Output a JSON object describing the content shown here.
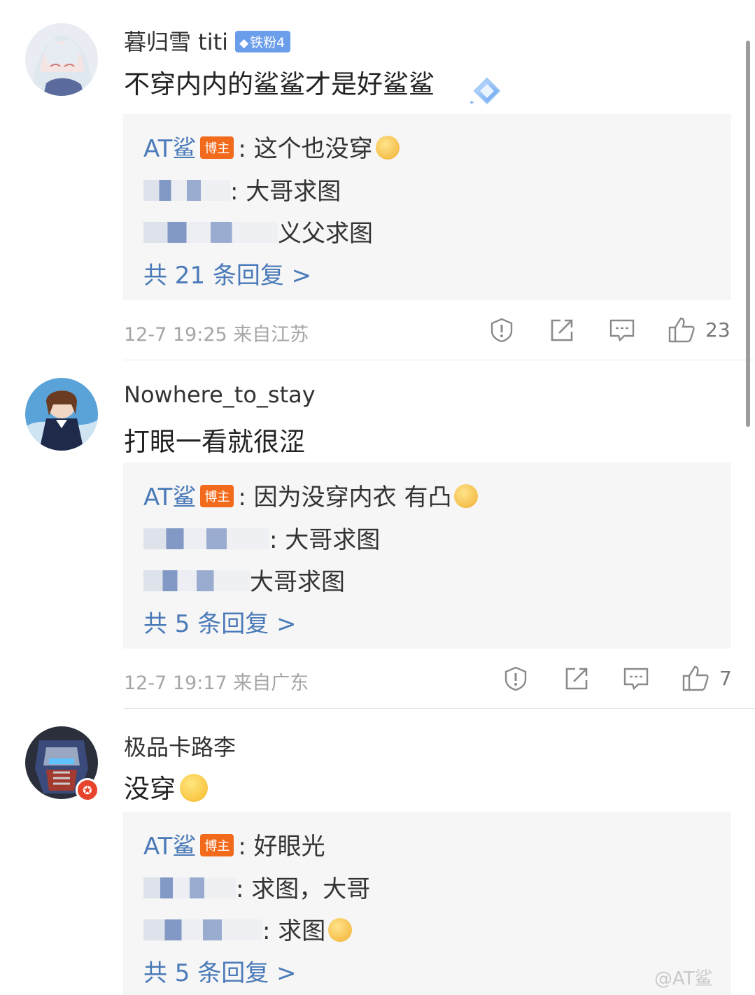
{
  "comments": [
    {
      "username": "暮归雪 titi",
      "badge": "铁粉4",
      "text": "不穿内内的鲨鲨才是好鲨鲨",
      "replies": [
        {
          "name": "AT鲨",
          "tag": "博主",
          "sep": ":",
          "text": " 这个也没穿"
        },
        {
          "name": "",
          "text": ": 大哥求图"
        },
        {
          "name": "",
          "text": "义父求图"
        }
      ],
      "more": "共 21 条回复 >",
      "time": "12-7 19:25",
      "location": "来自江苏",
      "likes": "23"
    },
    {
      "username": "Nowhere_to_stay",
      "text": "打眼一看就很涩",
      "replies": [
        {
          "name": "AT鲨",
          "tag": "博主",
          "sep": ":",
          "text": " 因为没穿内衣 有凸"
        },
        {
          "name": "",
          "text": ": 大哥求图"
        },
        {
          "name": "",
          "text": "大哥求图"
        }
      ],
      "more": "共 5 条回复 >",
      "time": "12-7 19:17",
      "location": "来自广东",
      "likes": "7"
    },
    {
      "username": "极品卡路李",
      "text": "没穿",
      "replies": [
        {
          "name": "AT鲨",
          "tag": "博主",
          "sep": ":",
          "text": " 好眼光"
        },
        {
          "name": "",
          "text": ": 求图，大哥"
        },
        {
          "name": "",
          "text": ": 求图"
        }
      ],
      "more": "共 5 条回复 >"
    }
  ],
  "watermark": "@AT鲨",
  "icons": {
    "report": "shield-exclamation-icon",
    "share": "share-icon",
    "comment": "comment-icon",
    "like": "thumbs-up-icon"
  },
  "colors": {
    "link": "#4a7ab8",
    "blogger_tag": "#f26a1b",
    "reply_bg": "#f6f6f6",
    "meta": "#a6a6a6"
  }
}
